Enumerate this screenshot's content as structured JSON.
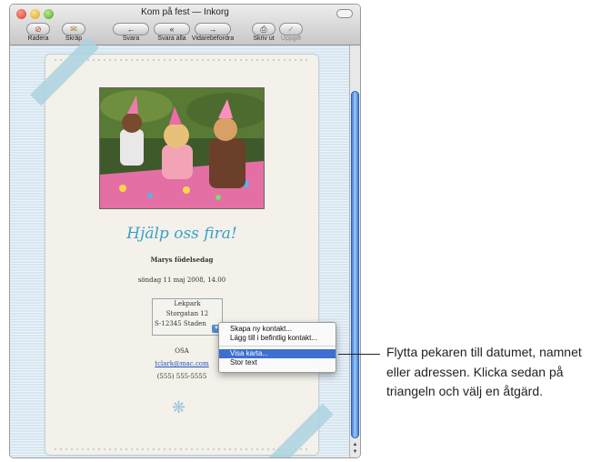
{
  "window": {
    "title": "Kom på fest — Inkorg"
  },
  "toolbar": [
    {
      "label": "Radera",
      "icon": "⊘",
      "enabled": true
    },
    {
      "label": "Skräp",
      "icon": "✉",
      "enabled": true
    },
    {
      "label": "Svara",
      "icon": "←",
      "enabled": true
    },
    {
      "label": "Svara alla",
      "icon": "«",
      "enabled": true
    },
    {
      "label": "Vidarebefordra",
      "icon": "→",
      "enabled": true
    },
    {
      "label": "Skriv ut",
      "icon": "⎙",
      "enabled": true
    },
    {
      "label": "Uppgift",
      "icon": "✓",
      "enabled": false
    }
  ],
  "card": {
    "title": "Hjälp oss fira!",
    "subtitle": "Marys födelsedag",
    "date": "söndag 11 maj 2008, 14.00",
    "address": [
      "Lekpark",
      "Storgatan 12",
      "S-12345 Staden"
    ],
    "osa_label": "OSA",
    "email": "tclark@mac.com",
    "phone": "(555) 555-5555"
  },
  "context_menu": {
    "items": [
      "Skapa ny kontakt...",
      "Lägg till i befintlig kontakt...",
      "Visa karta...",
      "Stor text"
    ],
    "highlighted": "Visa karta..."
  },
  "callout": {
    "text": "Flytta pekaren till datumet, namnet eller adressen. Klicka sedan på triangeln och välj en åtgärd."
  },
  "colors": {
    "title_blue": "#3aa0c8",
    "menu_highlight": "#3d6fd0",
    "link_blue": "#2755b5",
    "ribbon": "#acd2e1"
  }
}
